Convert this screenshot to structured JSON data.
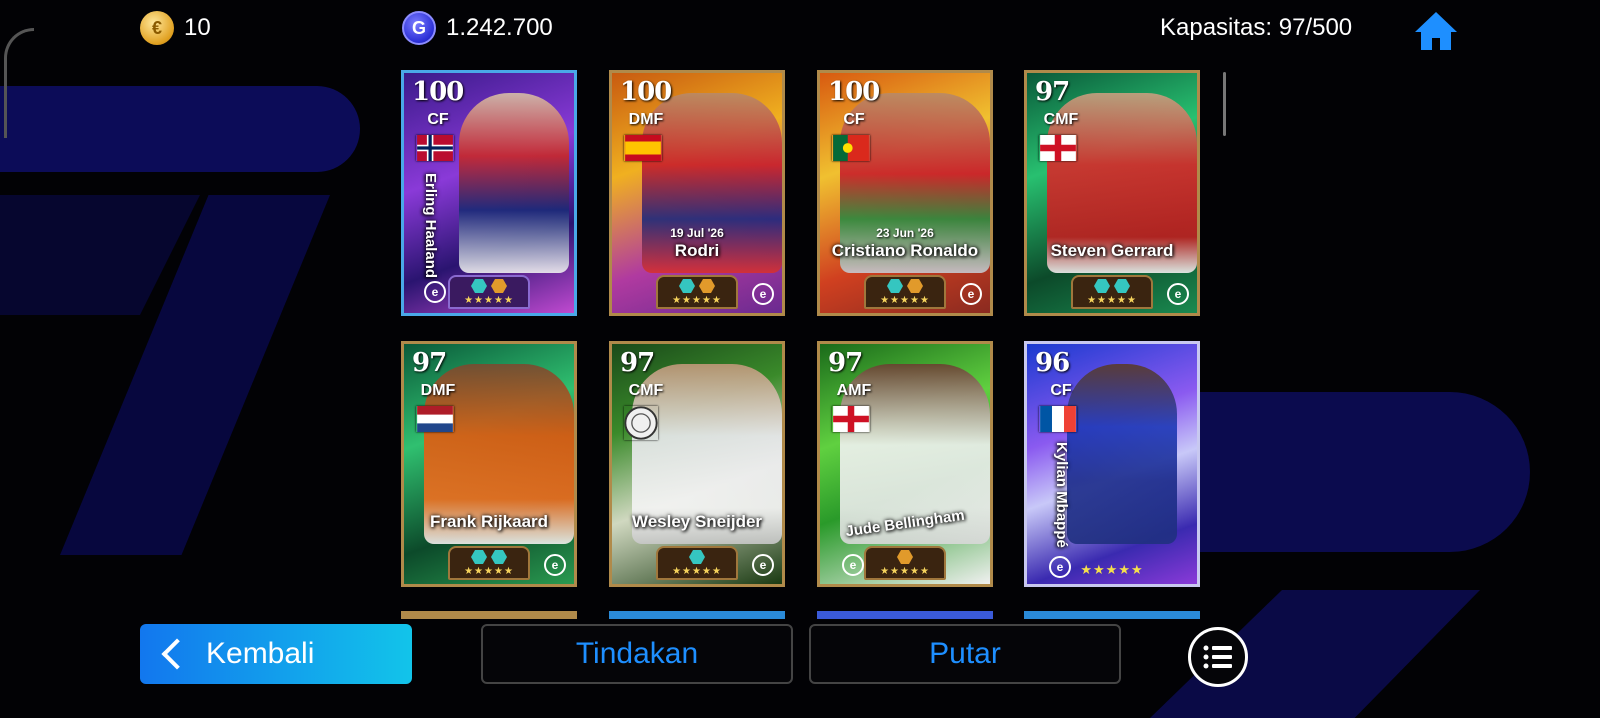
{
  "topbar": {
    "coins_value": "10",
    "coins_icon": "e-coin-icon",
    "gp_value": "1.242.700",
    "gp_icon": "gp-icon",
    "capacity_text": "Kapasitas: 97/500",
    "home_icon": "home-icon"
  },
  "cards": [
    {
      "rating": "100",
      "position": "CF",
      "name": "Erling Haaland",
      "date": "",
      "flag": "Norway",
      "stars": "★★★★★",
      "skill_colors": [
        "teal",
        "gold"
      ]
    },
    {
      "rating": "100",
      "position": "DMF",
      "name": "Rodri",
      "date": "19 Jul '26",
      "flag": "Spain",
      "stars": "★★★★★",
      "skill_colors": [
        "teal",
        "gold"
      ]
    },
    {
      "rating": "100",
      "position": "CF",
      "name": "Cristiano Ronaldo",
      "date": "23 Jun '26",
      "flag": "Portugal",
      "stars": "★★★★★",
      "skill_colors": [
        "teal",
        "gold"
      ]
    },
    {
      "rating": "97",
      "position": "CMF",
      "name": "Steven Gerrard",
      "date": "",
      "flag": "England",
      "stars": "★★★★★",
      "skill_colors": [
        "teal",
        "teal"
      ]
    },
    {
      "rating": "97",
      "position": "DMF",
      "name": "Frank Rijkaard",
      "date": "",
      "flag": "Netherlands",
      "stars": "★★★★★",
      "skill_colors": [
        "teal",
        "teal"
      ]
    },
    {
      "rating": "97",
      "position": "CMF",
      "name": "Wesley Sneijder",
      "date": "",
      "flag": "Club crest",
      "stars": "★★★★★",
      "skill_colors": [
        "teal"
      ]
    },
    {
      "rating": "97",
      "position": "AMF",
      "name": "Jude Bellingham",
      "date": "",
      "flag": "England",
      "stars": "★★★★★",
      "skill_colors": [
        "gold"
      ]
    },
    {
      "rating": "96",
      "position": "CF",
      "name": "Kylian Mbappé",
      "date": "",
      "flag": "France",
      "stars": "★★★★★",
      "skill_colors": []
    }
  ],
  "buttons": {
    "back_label": "Kembali",
    "actions_label": "Tindakan",
    "play_label": "Putar",
    "list_icon": "list-icon"
  },
  "colors": {
    "accent_blue": "#1e8fff",
    "back_gradient_start": "#1277ee",
    "back_gradient_end": "#12c4ea",
    "card_border_gold": "#b08a4a"
  }
}
